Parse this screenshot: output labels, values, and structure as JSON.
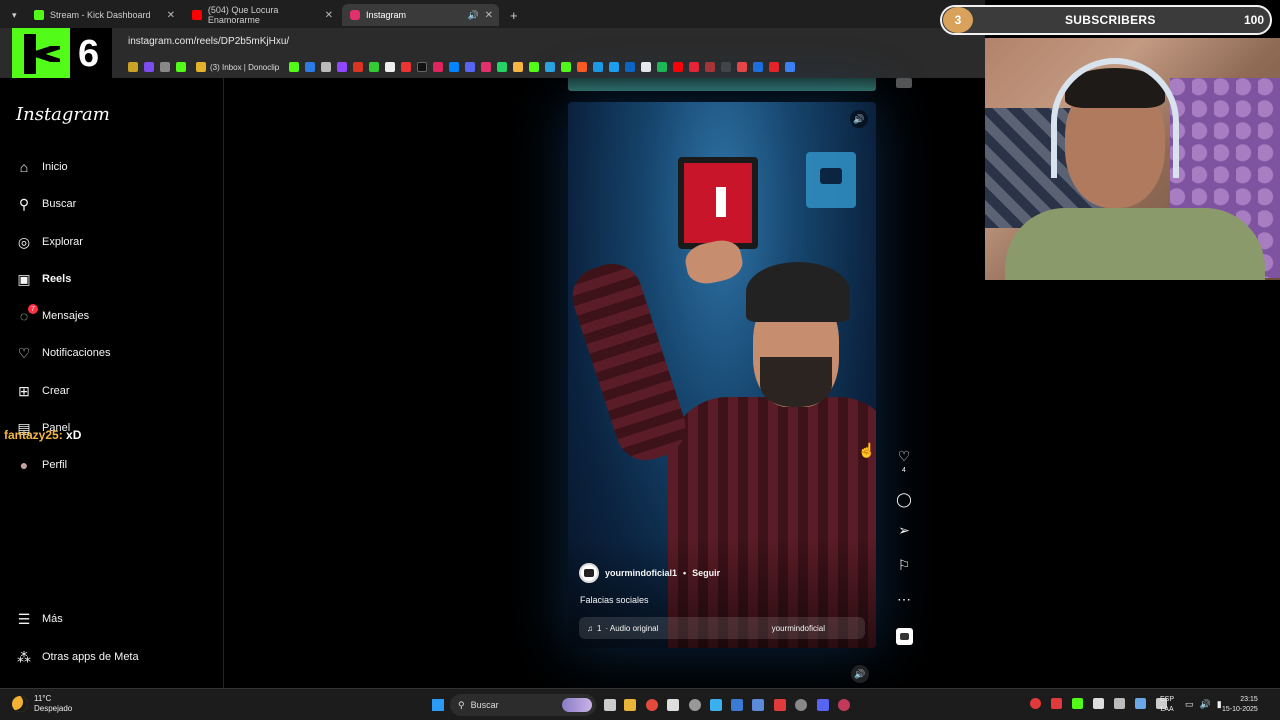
{
  "browser": {
    "tabs": [
      {
        "label": "Stream - Kick Dashboard",
        "color": "#53fc18"
      },
      {
        "label": "(504) Que Locura Enamorarme",
        "color": "#ff0000"
      },
      {
        "label": "Instagram",
        "color": "#e1306c"
      }
    ],
    "new_tab": "+",
    "url": "instagram.com/reels/DP2b5mKjHxu/",
    "bookmark_inbox": "(3) Inbox | Donoclip"
  },
  "kick_overlay": {
    "follower_count": "6"
  },
  "sidebar": {
    "logo": "Instagram",
    "items": [
      {
        "label": "Inicio",
        "icon": "home-icon",
        "glyph": "⌂"
      },
      {
        "label": "Buscar",
        "icon": "search-icon",
        "glyph": "⚲"
      },
      {
        "label": "Explorar",
        "icon": "compass-icon",
        "glyph": "◎"
      },
      {
        "label": "Reels",
        "icon": "reels-icon",
        "glyph": "▣"
      },
      {
        "label": "Mensajes",
        "icon": "messenger-icon",
        "glyph": "◌",
        "badge": "7"
      },
      {
        "label": "Notificaciones",
        "icon": "heart-icon",
        "glyph": "♡"
      },
      {
        "label": "Crear",
        "icon": "plus-icon",
        "glyph": "⊞"
      },
      {
        "label": "Panel",
        "icon": "dashboard-icon",
        "glyph": "▤"
      },
      {
        "label": "Perfil",
        "icon": "profile-icon",
        "glyph": "●"
      },
      {
        "label": "Más",
        "icon": "menu-icon",
        "glyph": "☰"
      },
      {
        "label": "Otras apps de Meta",
        "icon": "meta-icon",
        "glyph": "⁂"
      }
    ]
  },
  "chat_message": {
    "user": "fantazy25:",
    "text": "xD"
  },
  "reel": {
    "author": "yourmindoficial1",
    "separator": "•",
    "follow_label": "Seguir",
    "caption": "Falacias sociales",
    "audio_count": "1",
    "audio_label": "· Audio original",
    "audio_author": "yourmindoficial",
    "likes": "4"
  },
  "overlay": {
    "subscribers_label": "SUBSCRIBERS",
    "subscribers_count": "3",
    "subscribers_goal": "100",
    "accent": "#d8a25a"
  },
  "taskbar": {
    "temperature": "11°C",
    "weather": "Despejado",
    "search_placeholder": "Buscar",
    "lang_top": "ESP",
    "lang_bottom": "LAA",
    "time": "23:15",
    "date": "15-10-2025"
  }
}
